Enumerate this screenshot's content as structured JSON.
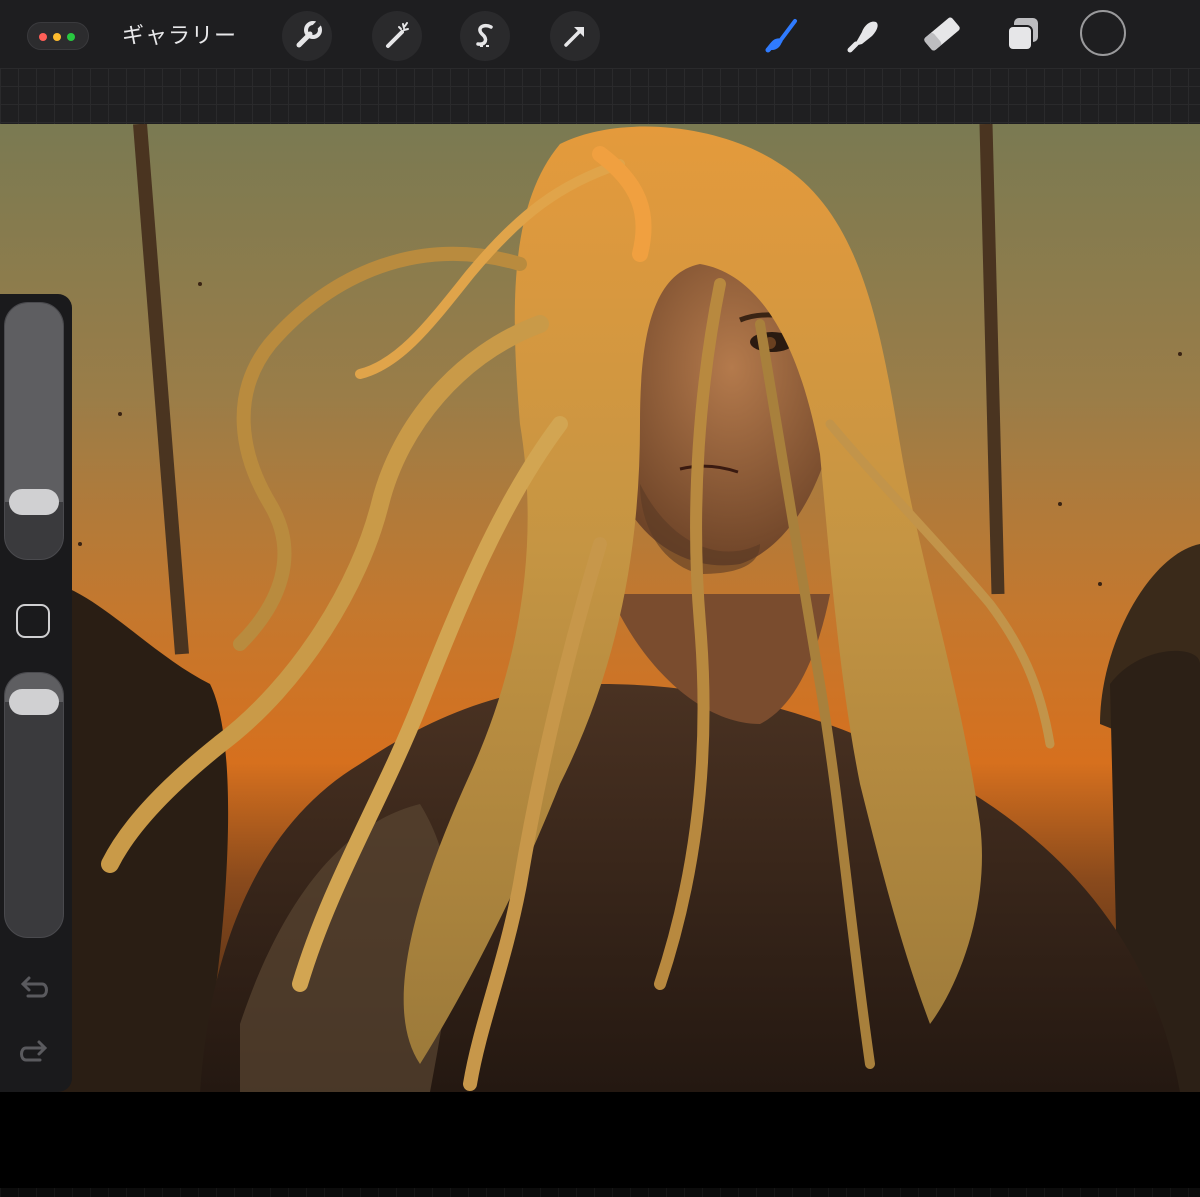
{
  "toolbar": {
    "gallery_label": "ギャラリー",
    "left_tools": [
      "wrench-icon",
      "magic-wand-icon",
      "selection-icon",
      "transform-arrow-icon"
    ],
    "right_tools": [
      "brush-icon",
      "smudge-icon",
      "eraser-icon",
      "layers-icon"
    ],
    "active_tool": "brush-icon",
    "active_color": "#1e1e20",
    "accent": "#2f7bff"
  },
  "sidebar": {
    "brush_size_level": 0.82,
    "opacity_level": 0.05,
    "icons": [
      "modify-square-icon",
      "undo-icon",
      "redo-icon"
    ]
  },
  "canvas": {
    "artwork": "illustration-long-haired-warrior-at-sunset"
  }
}
